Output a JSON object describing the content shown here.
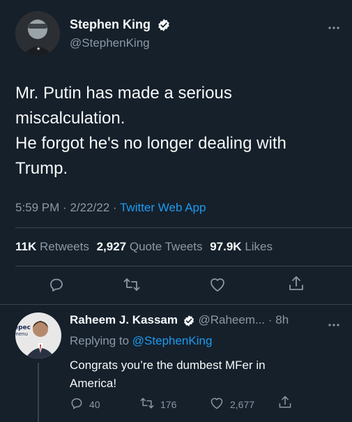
{
  "main_tweet": {
    "author_name": "Stephen King",
    "author_handle": "@StephenKing",
    "text_lines": [
      "Mr. Putin has made a serious",
      "miscalculation.",
      "He forgot he's no longer dealing with",
      "Trump."
    ],
    "time": "5:59 PM",
    "date": "2/22/22",
    "source": "Twitter Web App",
    "stats": {
      "retweets_count": "11K",
      "retweets_label": "Retweets",
      "quotes_count": "2,927",
      "quotes_label": "Quote Tweets",
      "likes_count": "97.9K",
      "likes_label": "Likes"
    }
  },
  "reply": {
    "author_name": "Raheem J. Kassam",
    "author_handle": "@Raheem...",
    "age": "8h",
    "replying_to_label": "Replying to",
    "replying_to_handle": "@StephenKing",
    "text_lines": [
      "Congrats you’re the dumbest MFer in",
      "America!"
    ],
    "actions": {
      "replies": "40",
      "retweets": "176",
      "likes": "2,677"
    }
  },
  "colors": {
    "background": "#15202b",
    "text": "#f7f9f9",
    "muted": "#8b98a5",
    "accent": "#1d9bf0"
  }
}
